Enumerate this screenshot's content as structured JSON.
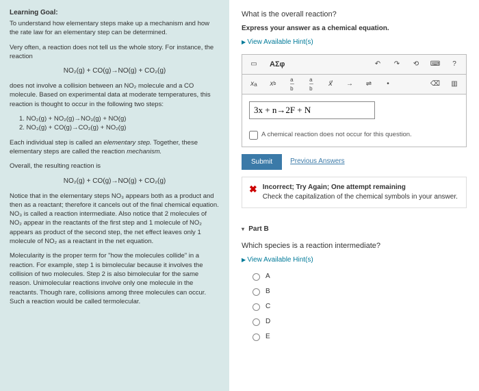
{
  "left": {
    "heading": "Learning Goal:",
    "intro": "To understand how elementary steps make up a mechanism and how the rate law for an elementary step can be determined.",
    "p2": "Very often, a reaction does not tell us the whole story. For instance, the reaction",
    "eq1": "NO₂(g) + CO(g)→NO(g) + CO₂(g)",
    "p3": "does not involve a collision between an NO₂ molecule and a CO molecule. Based on experimental data at moderate temperatures, this reaction is thought to occur in the following two steps:",
    "step1": "1. NO₂(g) + NO₂(g)→NO₃(g) + NO(g)",
    "step2": "2. NO₃(g) + CO(g)→CO₂(g) + NO₂(g)",
    "p4a": "Each individual step is called an ",
    "p4b": "elementary step.",
    "p4c": " Together, these elementary steps are called the reaction ",
    "p4d": "mechanism.",
    "p5": "Overall, the resulting reaction is",
    "eq2": "NO₂(g) + CO(g)→NO(g) + CO₂(g)",
    "p6": "Notice that in the elementary steps NO₃ appears both as a product and then as a reactant; therefore it cancels out of the final chemical equation. NO₃ is called a reaction intermediate. Also notice that 2 molecules of NO₂ appear in the reactants of the first step and 1 molecule of NO₂ appears as product of the second step, the net effect leaves only 1 molecule of NO₂ as a reactant in the net equation.",
    "p7": "Molecularity is the proper term for \"how the molecules collide\" in a reaction. For example, step 1 is bimolecular because it involves the collision of two molecules. Step 2 is also bimolecular for the same reason. Unimolecular reactions involve only one molecule in the reactants. Though rare, collisions among three molecules can occur. Such a reaction would be called termolecular."
  },
  "right": {
    "q1": "What is the overall reaction?",
    "instr1": "Express your answer as a chemical equation.",
    "hints": "View Available Hint(s)",
    "greek": "ΑΣφ",
    "answer": "3x + n→2F + N",
    "noReact": "A chemical reaction does not occur for this question.",
    "submit": "Submit",
    "prev": "Previous Answers",
    "fb_title": "Incorrect; Try Again; One attempt remaining",
    "fb_msg": "Check the capitalization of the chemical symbols in your answer.",
    "partB": "Part B",
    "q2": "Which species is a reaction intermediate?",
    "opts": {
      "a": "A",
      "b": "B",
      "c": "C",
      "d": "D",
      "e": "E"
    }
  }
}
